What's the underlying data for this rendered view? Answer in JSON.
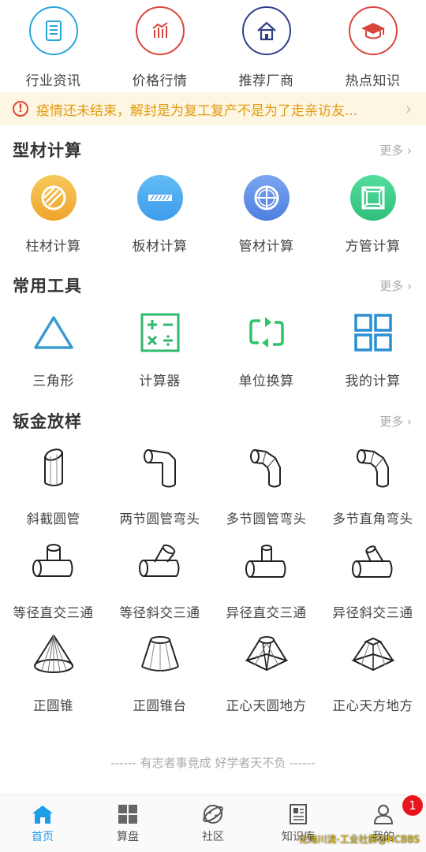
{
  "topnav": [
    {
      "label": "行业资讯",
      "icon": "news-icon",
      "color": "#2aa5d8"
    },
    {
      "label": "价格行情",
      "icon": "price-chart-icon",
      "color": "#d9453c"
    },
    {
      "label": "推荐厂商",
      "icon": "home-icon",
      "color": "#2f3f88"
    },
    {
      "label": "热点知识",
      "icon": "graduation-cap-icon",
      "color": "#d9453c"
    }
  ],
  "notice": {
    "text": "疫情还未结束，解封是为复工复产不是为了走亲访友...",
    "text_color": "#e39b10"
  },
  "sections": {
    "profile": {
      "title": "型材计算",
      "more": "更多"
    },
    "tools": {
      "title": "常用工具",
      "more": "更多"
    },
    "sheet": {
      "title": "钣金放样",
      "more": "更多"
    }
  },
  "profile_items": [
    {
      "label": "柱材计算",
      "icon": "round-bar-icon",
      "color": "#f2b13a"
    },
    {
      "label": "板材计算",
      "icon": "plate-icon",
      "color": "#4aaaf0"
    },
    {
      "label": "管材计算",
      "icon": "pipe-icon",
      "color": "#5a8de8"
    },
    {
      "label": "方管计算",
      "icon": "square-tube-icon",
      "color": "#3dc98a"
    }
  ],
  "tool_items": [
    {
      "label": "三角形",
      "icon": "triangle-icon",
      "color": "#3b9ad0"
    },
    {
      "label": "计算器",
      "icon": "calculator-icon",
      "color": "#2fb86f"
    },
    {
      "label": "单位换算",
      "icon": "unit-convert-icon",
      "color": "#2fc46a"
    },
    {
      "label": "我的计算",
      "icon": "grid-icon",
      "color": "#2a8fd3"
    }
  ],
  "sheet_items": [
    {
      "label": "斜截圆管",
      "icon": "oblique-cut-pipe-icon"
    },
    {
      "label": "两节圆管弯头",
      "icon": "two-segment-elbow-icon"
    },
    {
      "label": "多节圆管弯头",
      "icon": "multi-segment-elbow-icon"
    },
    {
      "label": "多节直角弯头",
      "icon": "multi-segment-right-elbow-icon"
    },
    {
      "label": "等径直交三通",
      "icon": "equal-tee-icon"
    },
    {
      "label": "等径斜交三通",
      "icon": "equal-oblique-tee-icon"
    },
    {
      "label": "异径直交三通",
      "icon": "reducing-tee-icon"
    },
    {
      "label": "异径斜交三通",
      "icon": "reducing-oblique-tee-icon"
    },
    {
      "label": "正圆锥",
      "icon": "cone-icon"
    },
    {
      "label": "正圆锥台",
      "icon": "frustum-icon"
    },
    {
      "label": "正心天圆地方",
      "icon": "round-to-square-icon"
    },
    {
      "label": "正心天方地方",
      "icon": "square-to-square-icon"
    }
  ],
  "motto": "------ 有志者事竟成 好学者天不负 ------",
  "tabs": [
    {
      "label": "首页",
      "icon": "home-tab-icon",
      "active": true
    },
    {
      "label": "算盘",
      "icon": "abacus-grid-icon",
      "active": false
    },
    {
      "label": "社区",
      "icon": "community-planet-icon",
      "active": false
    },
    {
      "label": "知识库",
      "icon": "knowledge-book-icon",
      "active": false
    },
    {
      "label": "我的",
      "icon": "user-icon",
      "active": false,
      "badge": "1"
    }
  ],
  "watermark": "化海川流-工业社群@HCBBS",
  "colors": {
    "accent": "#1f9ee8",
    "notice_bg": "#fdf6e3",
    "badge": "#e8141e"
  }
}
